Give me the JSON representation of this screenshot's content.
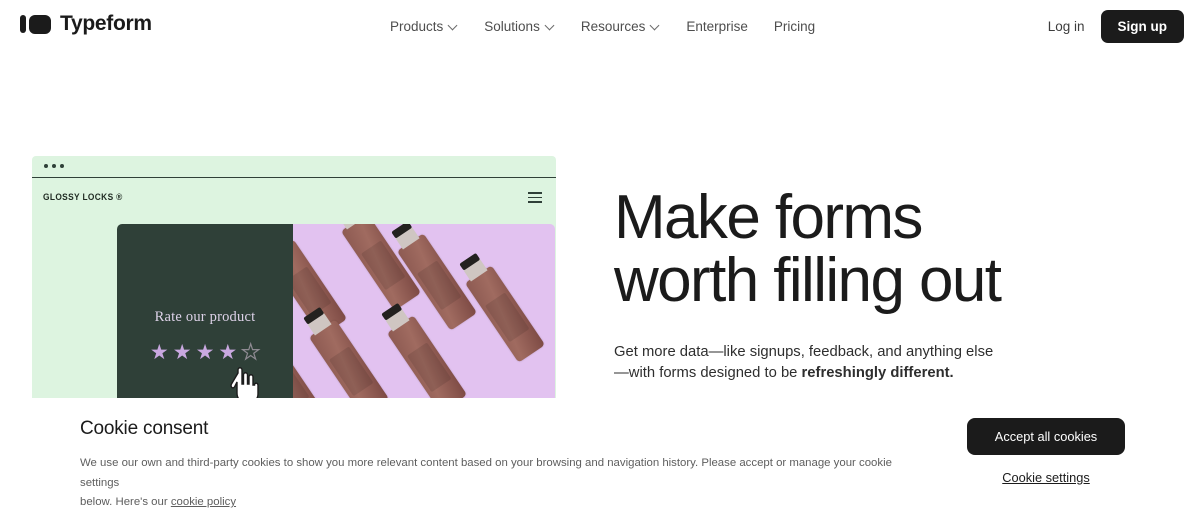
{
  "header": {
    "brand_name": "Typeform",
    "logo_icon": "typeform-logo-icon",
    "nav": [
      {
        "label": "Products",
        "has_chevron": true
      },
      {
        "label": "Solutions",
        "has_chevron": true
      },
      {
        "label": "Resources",
        "has_chevron": true
      },
      {
        "label": "Enterprise",
        "has_chevron": false
      },
      {
        "label": "Pricing",
        "has_chevron": false
      }
    ],
    "login_label": "Log in",
    "signup_label": "Sign up"
  },
  "hero": {
    "title": "Make forms\nworth filling out",
    "subtitle_plain": "Get more data—like signups, feedback, and anything else\n—with forms designed to be ",
    "subtitle_bold": "refreshingly different."
  },
  "mockup": {
    "brand_label": "GLOSSY LOCKS ®",
    "menu_icon": "hamburger-menu-icon",
    "rate_title": "Rate our product",
    "stars_filled": 4,
    "stars_total": 5,
    "cursor_icon": "hand-pointer-cursor-icon",
    "window_dots": 3
  },
  "cookie_banner": {
    "title": "Cookie consent",
    "body_line1": "We use our own and third-party cookies to show you more relevant content based on your browsing and navigation history. Please accept or manage your cookie settings",
    "body_line2_prefix": "below. Here's our ",
    "policy_link": "cookie policy",
    "accept_label": "Accept all cookies",
    "settings_label": "Cookie settings"
  },
  "colors": {
    "brand_black": "#1b1b1b",
    "mockup_mint": "#ddf4e0",
    "mockup_dark_green": "#2f4038",
    "mockup_lavender": "#e2c2f0",
    "star_purple": "#c9a8e0",
    "bottle_brown": "#8d5a52"
  }
}
